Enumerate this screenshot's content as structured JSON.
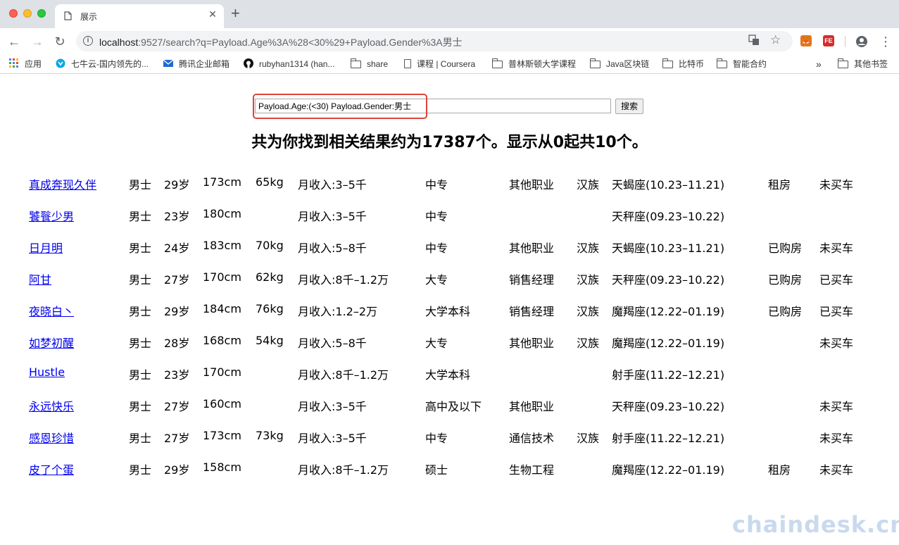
{
  "browser": {
    "tab_title": "展示",
    "url_host": "localhost",
    "url_rest": ":9527/search?q=Payload.Age%3A%28<30%29+Payload.Gender%3A男士",
    "bookmarks": [
      {
        "label": "应用",
        "icon": "apps-grid-icon"
      },
      {
        "label": "七牛云-国内领先的...",
        "icon": "qiniu-icon"
      },
      {
        "label": "腾讯企业邮箱",
        "icon": "mail-icon"
      },
      {
        "label": "rubyhan1314 (han...",
        "icon": "github-icon"
      },
      {
        "label": "share",
        "icon": "folder-icon"
      },
      {
        "label": "课程 | Coursera",
        "icon": "page-icon"
      },
      {
        "label": "普林斯顿大学课程",
        "icon": "folder-icon"
      },
      {
        "label": "Java区块链",
        "icon": "folder-icon"
      },
      {
        "label": "比特币",
        "icon": "folder-icon"
      },
      {
        "label": "智能合约",
        "icon": "folder-icon"
      }
    ],
    "more_bookmarks": "»",
    "other_bookmarks": "其他书签"
  },
  "search": {
    "query": "Payload.Age:(<30) Payload.Gender:男士",
    "button_label": "搜索"
  },
  "summary": "共为你找到相关结果约为17387个。显示从0起共10个。",
  "results": [
    {
      "name": "真成奔现久伴",
      "gender": "男士",
      "age": "29岁",
      "height": "173cm",
      "weight": "65kg",
      "income": "月收入:3–5千",
      "education": "中专",
      "job": "其他职业",
      "ethnicity": "汉族",
      "zodiac": "天蝎座(10.23–11.21)",
      "house": "租房",
      "car": "未买车"
    },
    {
      "name": "饕餮少男",
      "gender": "男士",
      "age": "23岁",
      "height": "180cm",
      "weight": "",
      "income": "月收入:3–5千",
      "education": "中专",
      "job": "",
      "ethnicity": "",
      "zodiac": "天秤座(09.23–10.22)",
      "house": "",
      "car": ""
    },
    {
      "name": "日月明",
      "gender": "男士",
      "age": "24岁",
      "height": "183cm",
      "weight": "70kg",
      "income": "月收入:5–8千",
      "education": "中专",
      "job": "其他职业",
      "ethnicity": "汉族",
      "zodiac": "天蝎座(10.23–11.21)",
      "house": "已购房",
      "car": "未买车"
    },
    {
      "name": "阿甘",
      "gender": "男士",
      "age": "27岁",
      "height": "170cm",
      "weight": "62kg",
      "income": "月收入:8千–1.2万",
      "education": "大专",
      "job": "销售经理",
      "ethnicity": "汉族",
      "zodiac": "天秤座(09.23–10.22)",
      "house": "已购房",
      "car": "已买车"
    },
    {
      "name": "夜晓白丶",
      "gender": "男士",
      "age": "29岁",
      "height": "184cm",
      "weight": "76kg",
      "income": "月收入:1.2–2万",
      "education": "大学本科",
      "job": "销售经理",
      "ethnicity": "汉族",
      "zodiac": "魔羯座(12.22–01.19)",
      "house": "已购房",
      "car": "已买车"
    },
    {
      "name": "如梦初醒",
      "gender": "男士",
      "age": "28岁",
      "height": "168cm",
      "weight": "54kg",
      "income": "月收入:5–8千",
      "education": "大专",
      "job": "其他职业",
      "ethnicity": "汉族",
      "zodiac": "魔羯座(12.22–01.19)",
      "house": "",
      "car": "未买车"
    },
    {
      "name": "Hustle",
      "gender": "男士",
      "age": "23岁",
      "height": "170cm",
      "weight": "",
      "income": "月收入:8千–1.2万",
      "education": "大学本科",
      "job": "",
      "ethnicity": "",
      "zodiac": "射手座(11.22–12.21)",
      "house": "",
      "car": ""
    },
    {
      "name": "永远快乐",
      "gender": "男士",
      "age": "27岁",
      "height": "160cm",
      "weight": "",
      "income": "月收入:3–5千",
      "education": "高中及以下",
      "job": "其他职业",
      "ethnicity": "",
      "zodiac": "天秤座(09.23–10.22)",
      "house": "",
      "car": "未买车"
    },
    {
      "name": "感恩珍惜",
      "gender": "男士",
      "age": "27岁",
      "height": "173cm",
      "weight": "73kg",
      "income": "月收入:3–5千",
      "education": "中专",
      "job": "通信技术",
      "ethnicity": "汉族",
      "zodiac": "射手座(11.22–12.21)",
      "house": "",
      "car": "未买车"
    },
    {
      "name": "皮了个蛋",
      "gender": "男士",
      "age": "29岁",
      "height": "158cm",
      "weight": "",
      "income": "月收入:8千–1.2万",
      "education": "硕士",
      "job": "生物工程",
      "ethnicity": "",
      "zodiac": "魔羯座(12.22–01.19)",
      "house": "租房",
      "car": "未买车"
    }
  ],
  "watermark": "chaindesk.cn"
}
